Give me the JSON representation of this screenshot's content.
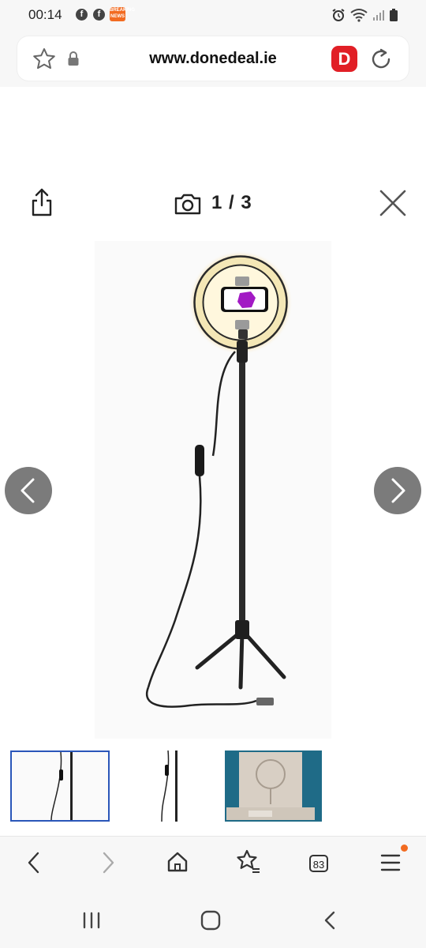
{
  "status_bar": {
    "time": "00:14",
    "fb_glyph": "f",
    "news_icon_text": "BREAKING NEWS",
    "icons": [
      "facebook-icon",
      "facebook-icon",
      "news-icon",
      "alarm-icon",
      "wifi-icon",
      "signal-icon",
      "battery-icon"
    ]
  },
  "browser": {
    "url": "www.donedeal.ie",
    "site_badge": "D",
    "tab_count": "83",
    "toolbar_icons": [
      "back-icon",
      "forward-icon",
      "home-icon",
      "bookmarks-icon",
      "tabs-icon",
      "menu-icon"
    ]
  },
  "gallery": {
    "counter": "1 / 3",
    "current_index": 1,
    "total": 3,
    "thumbnails": [
      "thumb-1",
      "thumb-2",
      "thumb-3"
    ],
    "selected_thumbnail": 1
  },
  "colors": {
    "brand_red": "#e11f26",
    "selected_border": "#2a56b9",
    "nav_circle": "#7b7b7b",
    "notify_dot": "#f26b21"
  }
}
